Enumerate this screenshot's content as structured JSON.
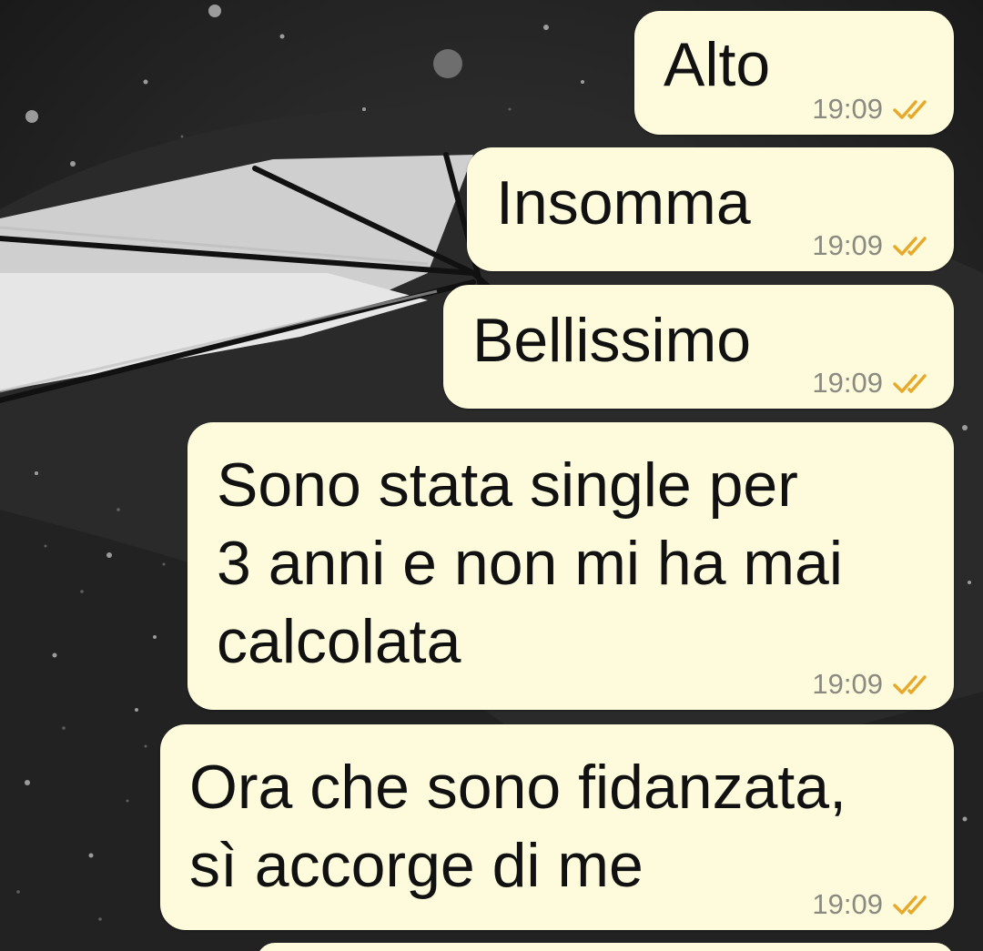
{
  "theme": {
    "bubble_color": "#fdfbdc",
    "tick_color": "#e7a92b",
    "time_color": "#8a8a80"
  },
  "messages": [
    {
      "text": "Alto",
      "time": "19:09",
      "status": "read-double-check-icon"
    },
    {
      "text": "Insomma",
      "time": "19:09",
      "status": "read-double-check-icon"
    },
    {
      "text": "Bellissimo",
      "time": "19:09",
      "status": "read-double-check-icon"
    },
    {
      "lines": [
        "Sono stata single per",
        "3 anni e non mi ha mai",
        "calcolata"
      ],
      "time": "19:09",
      "status": "read-double-check-icon"
    },
    {
      "lines": [
        "Ora che sono fidanzata,",
        "sì accorge di me"
      ],
      "time": "19:09",
      "status": "read-double-check-icon"
    }
  ]
}
